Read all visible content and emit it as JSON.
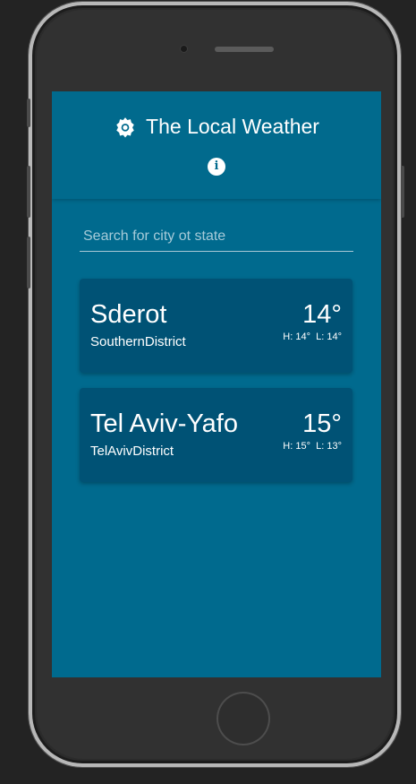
{
  "app": {
    "title": "The Local Weather",
    "accent_color": "#016a8d",
    "card_color": "#005275"
  },
  "header": {
    "logo_icon": "gear-icon",
    "info_icon": "info-icon",
    "info_glyph": "i"
  },
  "search": {
    "placeholder": "Search for city ot state",
    "value": ""
  },
  "cities": [
    {
      "name": "Sderot",
      "district": "SouthernDistrict",
      "temp": "14°",
      "high": "H: 14°",
      "low": "L: 14°"
    },
    {
      "name": "Tel Aviv-Yafo",
      "district": "TelAvivDistrict",
      "temp": "15°",
      "high": "H: 15°",
      "low": "L: 13°"
    }
  ]
}
